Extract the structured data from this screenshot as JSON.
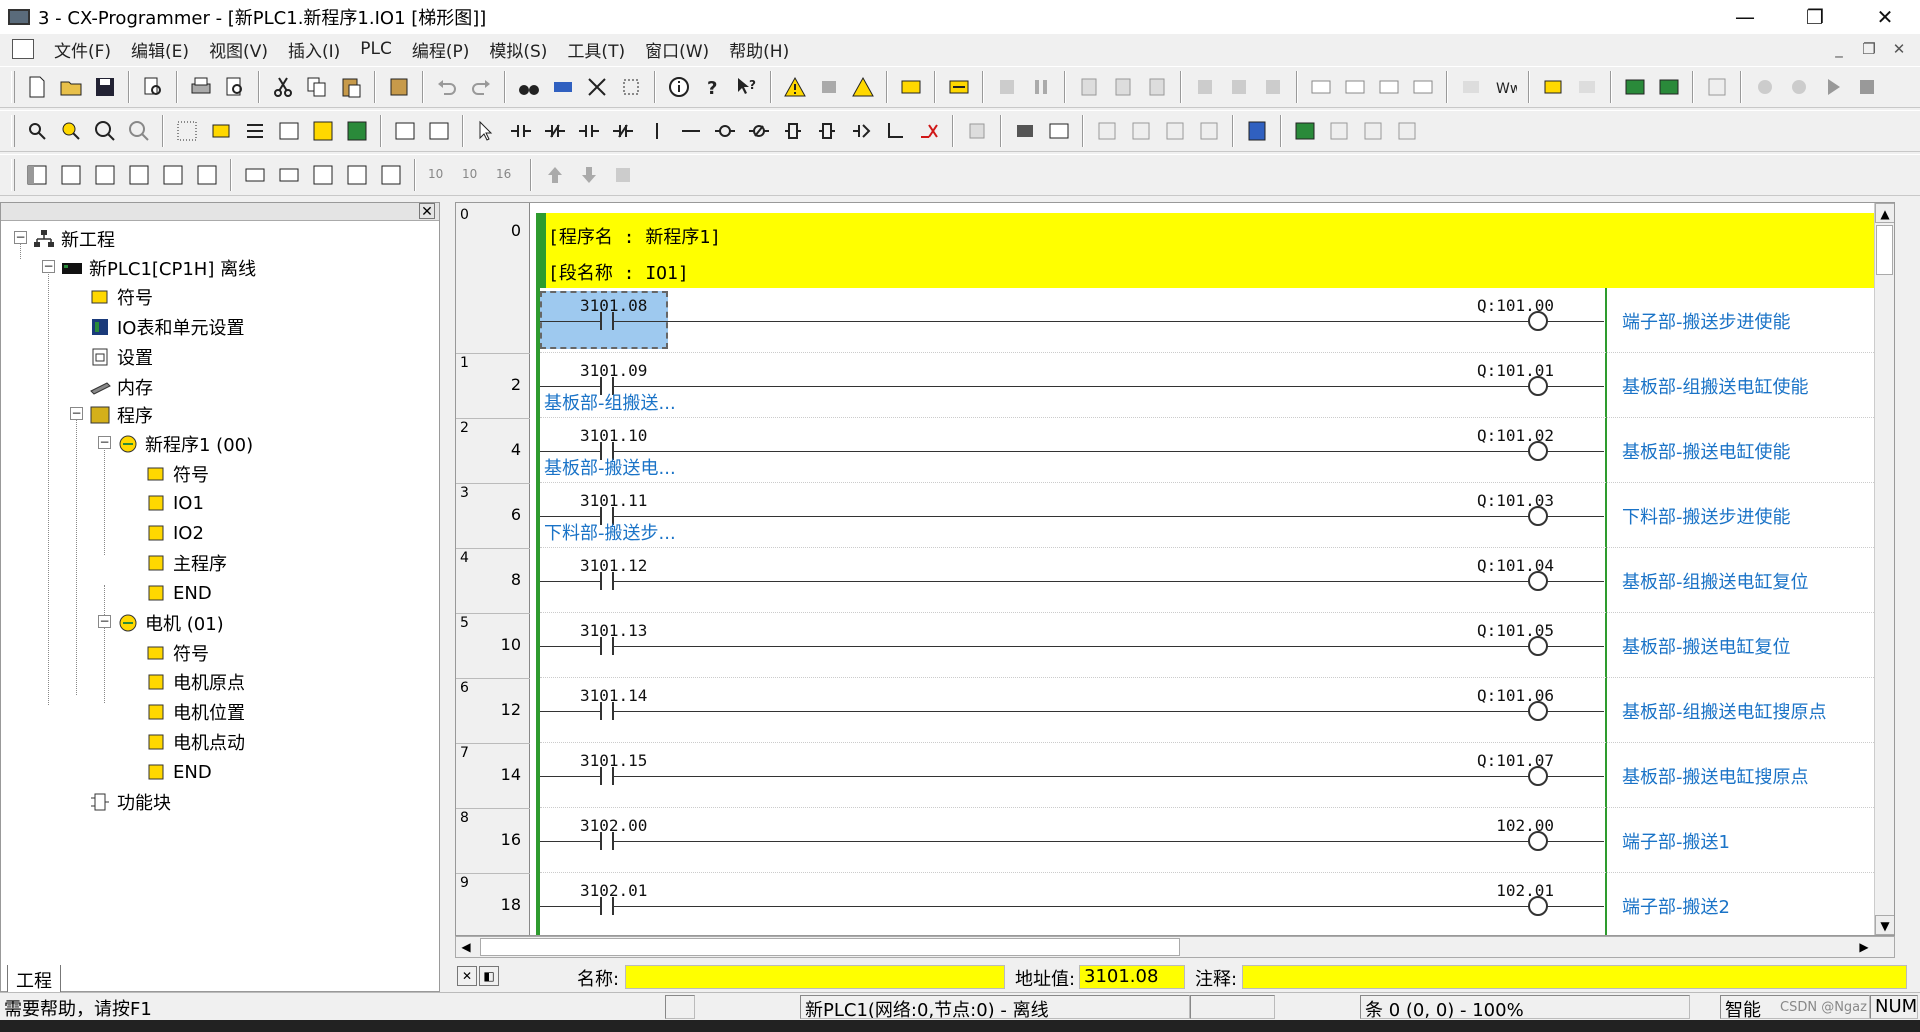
{
  "window": {
    "title": "3 - CX-Programmer - [新PLC1.新程序1.IO1 [梯形图]]",
    "min": "—",
    "max": "❐",
    "close": "✕"
  },
  "menu": [
    "文件(F)",
    "编辑(E)",
    "视图(V)",
    "插入(I)",
    "PLC",
    "编程(P)",
    "模拟(S)",
    "工具(T)",
    "窗口(W)",
    "帮助(H)"
  ],
  "tree": {
    "items": [
      {
        "label": "新工程"
      },
      {
        "label": "新PLC1[CP1H] 离线"
      },
      {
        "label": "符号"
      },
      {
        "label": "IO表和单元设置"
      },
      {
        "label": "设置"
      },
      {
        "label": "内存"
      },
      {
        "label": "程序"
      },
      {
        "label": "新程序1 (00)"
      },
      {
        "label": "符号"
      },
      {
        "label": "IO1"
      },
      {
        "label": "IO2"
      },
      {
        "label": "主程序"
      },
      {
        "label": "END"
      },
      {
        "label": "电机 (01)"
      },
      {
        "label": "符号"
      },
      {
        "label": "电机原点"
      },
      {
        "label": "电机位置"
      },
      {
        "label": "电机点动"
      },
      {
        "label": "END"
      },
      {
        "label": "功能块"
      }
    ],
    "tab": "工程"
  },
  "ladder": {
    "header": {
      "program_name": "[程序名 : 新程序1]",
      "section_name": "[段名称 : IO1]"
    },
    "rungs": [
      {
        "rung": "0",
        "step": "0",
        "input": "3101.08",
        "output": "Q:101.00",
        "out_comment": "端子部-搬送步进使能",
        "in_comment": ""
      },
      {
        "rung": "1",
        "step": "2",
        "input": "3101.09",
        "output": "Q:101.01",
        "out_comment": "基板部-组搬送电缸使能",
        "in_comment": "基板部-组搬送..."
      },
      {
        "rung": "2",
        "step": "4",
        "input": "3101.10",
        "output": "Q:101.02",
        "out_comment": "基板部-搬送电缸使能",
        "in_comment": "基板部-搬送电..."
      },
      {
        "rung": "3",
        "step": "6",
        "input": "3101.11",
        "output": "Q:101.03",
        "out_comment": "下料部-搬送步进使能",
        "in_comment": "下料部-搬送步..."
      },
      {
        "rung": "4",
        "step": "8",
        "input": "3101.12",
        "output": "Q:101.04",
        "out_comment": "基板部-组搬送电缸复位",
        "in_comment": ""
      },
      {
        "rung": "5",
        "step": "10",
        "input": "3101.13",
        "output": "Q:101.05",
        "out_comment": "基板部-搬送电缸复位",
        "in_comment": ""
      },
      {
        "rung": "6",
        "step": "12",
        "input": "3101.14",
        "output": "Q:101.06",
        "out_comment": "基板部-组搬送电缸搜原点",
        "in_comment": ""
      },
      {
        "rung": "7",
        "step": "14",
        "input": "3101.15",
        "output": "Q:101.07",
        "out_comment": "基板部-搬送电缸搜原点",
        "in_comment": ""
      },
      {
        "rung": "8",
        "step": "16",
        "input": "3102.00",
        "output": "102.00",
        "out_comment": "端子部-搬送1",
        "in_comment": ""
      },
      {
        "rung": "9",
        "step": "18",
        "input": "3102.01",
        "output": "102.01",
        "out_comment": "端子部-搬送2",
        "in_comment": ""
      }
    ]
  },
  "infobar": {
    "name_label": "名称:",
    "name_value": "",
    "address_label": "地址值:",
    "address_value": "3101.08",
    "comment_label": "注释:",
    "comment_value": ""
  },
  "status": {
    "help": "需要帮助，请按F1",
    "plc": "新PLC1(网络:0,节点:0) - 离线",
    "position": "条 0 (0, 0)  - 100%",
    "mode": "智能",
    "num": "NUM",
    "watermark": "CSDN @Ngaz"
  },
  "colors": {
    "rail": "#2e9b2e",
    "header_bg": "#ffff00",
    "comment": "#1a73c7",
    "selection": "#9ec9ef"
  }
}
